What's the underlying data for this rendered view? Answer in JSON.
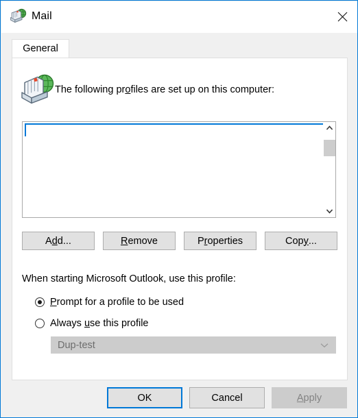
{
  "window": {
    "title": "Mail",
    "icon": "mail-profiles-icon",
    "close_label": "✕",
    "border_color": "#0078d7"
  },
  "tabs": [
    {
      "label": "General",
      "active": true
    }
  ],
  "main": {
    "profiles_icon": "profiles-card-file-icon",
    "profiles_label_pre": "The following pr",
    "profiles_label_acc": "o",
    "profiles_label_post": "files are set up on this computer:",
    "listbox": {
      "items": [],
      "selected_index": 0,
      "scrollbar": {
        "up_arrow": "chevron-up",
        "down_arrow": "chevron-down",
        "thumb_visible": true
      }
    },
    "buttons": [
      {
        "name": "add",
        "pre": "A",
        "acc": "d",
        "post": "d..."
      },
      {
        "name": "remove",
        "pre": "",
        "acc": "R",
        "post": "emove"
      },
      {
        "name": "properties",
        "pre": "P",
        "acc": "r",
        "post": "operties"
      },
      {
        "name": "copy",
        "pre": "Cop",
        "acc": "y",
        "post": "..."
      }
    ],
    "startup_label": "When starting Microsoft Outlook, use this profile:",
    "radios": [
      {
        "name": "prompt",
        "pre": "",
        "acc": "P",
        "post": "rompt for a profile to be used",
        "checked": true
      },
      {
        "name": "always",
        "pre": "Always ",
        "acc": "u",
        "post": "se this profile",
        "checked": false
      }
    ],
    "profile_combo": {
      "value": "Dup-test",
      "enabled": false,
      "arrow": "chevron-down"
    }
  },
  "footer": {
    "ok": {
      "label": "OK",
      "default": true
    },
    "cancel": {
      "label": "Cancel"
    },
    "apply": {
      "pre": "",
      "acc": "A",
      "post": "pply",
      "enabled": false
    }
  }
}
